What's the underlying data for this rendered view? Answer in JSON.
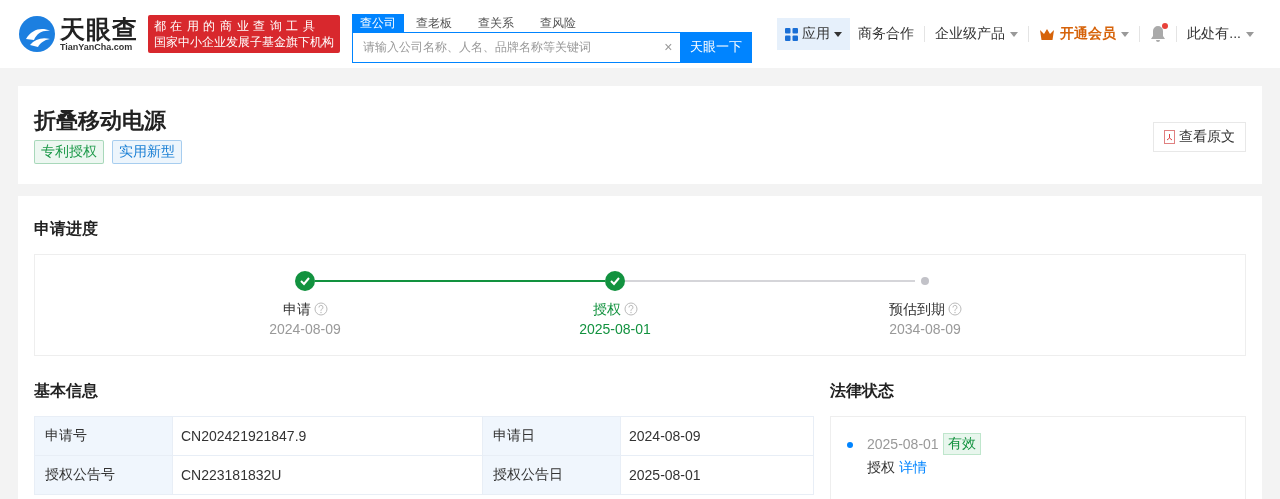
{
  "header": {
    "logo": {
      "name": "天眼查",
      "domain": "TianYanCha.com"
    },
    "slogan": [
      "都在用的商业查询工具",
      "国家中小企业发展子基金旗下机构"
    ],
    "search_tabs": [
      {
        "label": "查公司",
        "selected": true
      },
      {
        "label": "查老板",
        "selected": false
      },
      {
        "label": "查关系",
        "selected": false
      },
      {
        "label": "查风险",
        "selected": false
      }
    ],
    "search": {
      "placeholder": "请输入公司名称、人名、品牌名称等关键词",
      "clear": "×",
      "button": "天眼一下"
    },
    "nav": [
      {
        "kind": "apps",
        "label": "应用"
      },
      {
        "kind": "link",
        "label": "商务合作"
      },
      {
        "kind": "dropdown",
        "label": "企业级产品"
      },
      {
        "kind": "vip",
        "label": "开通会员"
      },
      {
        "kind": "bell",
        "unread": true
      },
      {
        "kind": "dropdown",
        "label": "此处有..."
      }
    ]
  },
  "title": "折叠移动电源",
  "tags": [
    {
      "label": "专利授权",
      "color": "#1f9a4b"
    },
    {
      "label": "实用新型",
      "color": "#1a7fd4"
    }
  ],
  "view_original": "查看原文",
  "progress": {
    "title": "申请进度",
    "steps": [
      {
        "label": "申请",
        "date": "2024-08-09",
        "done": true,
        "selected": false
      },
      {
        "label": "授权",
        "date": "2025-08-01",
        "done": true,
        "selected": true
      },
      {
        "label": "预估到期",
        "date": "2034-08-09",
        "done": false,
        "selected": false
      }
    ]
  },
  "basic_info": {
    "title": "基本信息",
    "rows": [
      [
        {
          "label": "申请号",
          "value": "CN202421921847.9"
        },
        {
          "label": "申请日",
          "value": "2024-08-09"
        }
      ],
      [
        {
          "label": "授权公告号",
          "value": "CN223181832U"
        },
        {
          "label": "授权公告日",
          "value": "2025-08-01"
        }
      ]
    ]
  },
  "legal_status": {
    "title": "法律状态",
    "entries": [
      {
        "date": "2025-08-01",
        "status": "有效",
        "event": "授权",
        "link": "详情"
      }
    ]
  }
}
